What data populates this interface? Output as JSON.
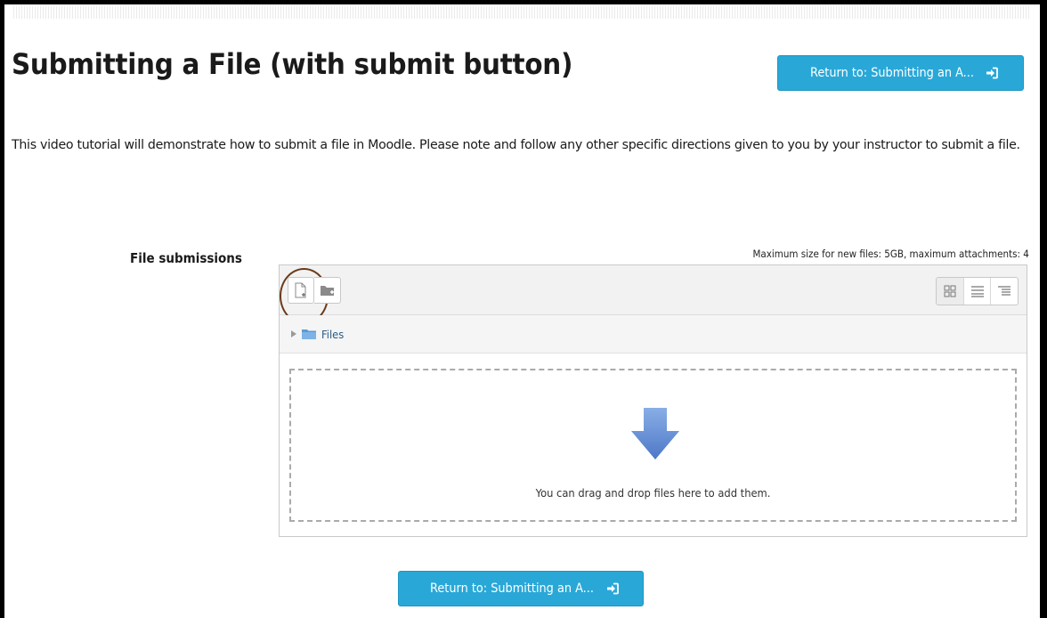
{
  "page": {
    "title": "Submitting a File (with submit button)",
    "intro": "This video tutorial will demonstrate how to submit a file in Moodle. Please note and follow any other specific directions given to you by your instructor to submit a file."
  },
  "return_button": {
    "label": "Return to: Submitting an A...",
    "icon": "sign-in-icon"
  },
  "file_submissions": {
    "label": "File submissions",
    "max_size_note": "Maximum size for new files: 5GB, maximum attachments: 4",
    "toolbar": {
      "add_file_icon": "add-file-icon",
      "create_folder_icon": "create-folder-icon",
      "view_modes": [
        "view-icons",
        "view-list",
        "view-tree"
      ]
    },
    "path": {
      "folder": "Files"
    },
    "drop_zone": {
      "text": "You can drag and drop files here to add them."
    }
  },
  "colors": {
    "button": "#29a8d8",
    "highlight_circle": "#6b3a1a",
    "arrow": "#6f95d8"
  }
}
